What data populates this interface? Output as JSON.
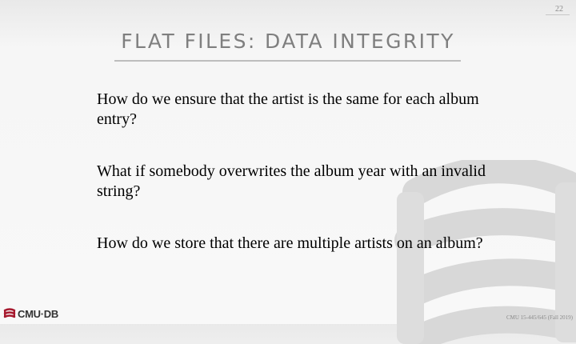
{
  "slide": {
    "page_number": "22",
    "title": "FLAT FILES: DATA INTEGRITY",
    "bullets": [
      {
        "text": "How do we ensure that the artist is the same for each album entry?"
      },
      {
        "text": "What if somebody overwrites the album year with an invalid string?"
      },
      {
        "text": "How do we store that there are multiple artists on an album?"
      }
    ]
  },
  "footer": {
    "logo_text": "CMU·DB",
    "course": "CMU 15-445/645 (Fall 2019)"
  },
  "colors": {
    "title": "#7f7f7f",
    "logo_red": "#a6192e",
    "watermark": "#d4d4d4"
  },
  "icons": {
    "logo": "database-icon",
    "watermark": "database-watermark-icon"
  }
}
